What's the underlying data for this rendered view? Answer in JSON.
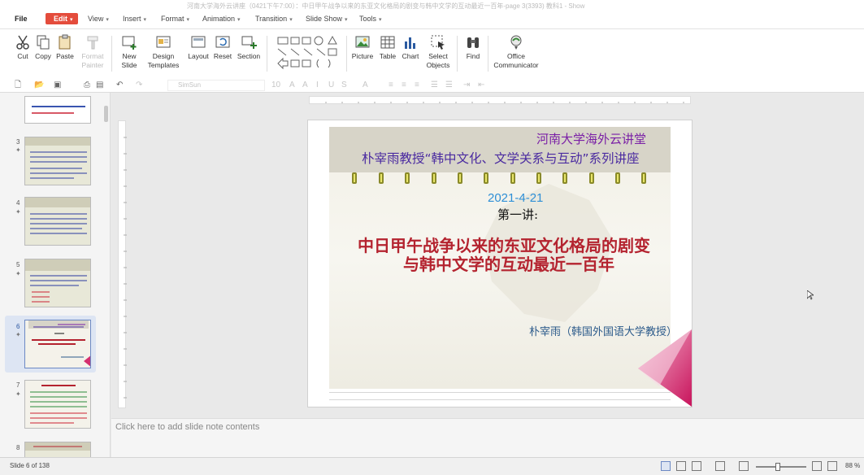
{
  "window": {
    "title": "河南大学海外云讲座（0421下午7:00）：中日甲午战争以来的东亚文化格局的剧变与韩中文学的互动最近一百年-page 3(3393) 教科1 - Show"
  },
  "menu": {
    "file": "File",
    "edit": "Edit",
    "view": "View",
    "insert": "Insert",
    "format": "Format",
    "animation": "Animation",
    "transition": "Transition",
    "slideshow": "Slide Show",
    "tools": "Tools"
  },
  "ribbon": {
    "cut": "Cut",
    "copy": "Copy",
    "paste": "Paste",
    "format_painter": "Format Painter",
    "new_slide": "New Slide",
    "design_templates": "Design Templates",
    "layout": "Layout",
    "reset": "Reset",
    "section": "Section",
    "picture": "Picture",
    "table": "Table",
    "chart": "Chart",
    "select_objects": "Select Objects",
    "find": "Find",
    "office_communicator": "Office Communicator"
  },
  "format_bar": {
    "font": "SimSun",
    "font_size": "10"
  },
  "thumbnails": [
    {
      "num": "",
      "bg": "#ffffff"
    },
    {
      "num": "3",
      "bg": "#e8e8d8"
    },
    {
      "num": "4",
      "bg": "#e8e8d8"
    },
    {
      "num": "5",
      "bg": "#e8e8d8"
    },
    {
      "num": "6",
      "bg": "#f4f2ea"
    },
    {
      "num": "7",
      "bg": "#f4f2ea"
    },
    {
      "num": "8",
      "bg": "#e8e8d8"
    }
  ],
  "slide": {
    "lecture_series": "河南大学海外云讲堂",
    "lecture_title": "朴宰雨教授“韩中文化、文学关系与互动”系列讲座",
    "date": "2021-4-21",
    "lecture_num": "第一讲:",
    "topic_line1": "中日甲午战争以来的东亚文化格局的剧变",
    "topic_line2": "与韩中文学的互动最近一百年",
    "author": "朴宰雨（韩国外国语大学教授）"
  },
  "notes": {
    "placeholder": "Click here to add slide note contents"
  },
  "status": {
    "slide_position": "Slide 6 of 138",
    "zoom": "88 %"
  },
  "colors": {
    "edit_tab": "#e44c3c",
    "selected_thumb": "#dde5f3"
  }
}
